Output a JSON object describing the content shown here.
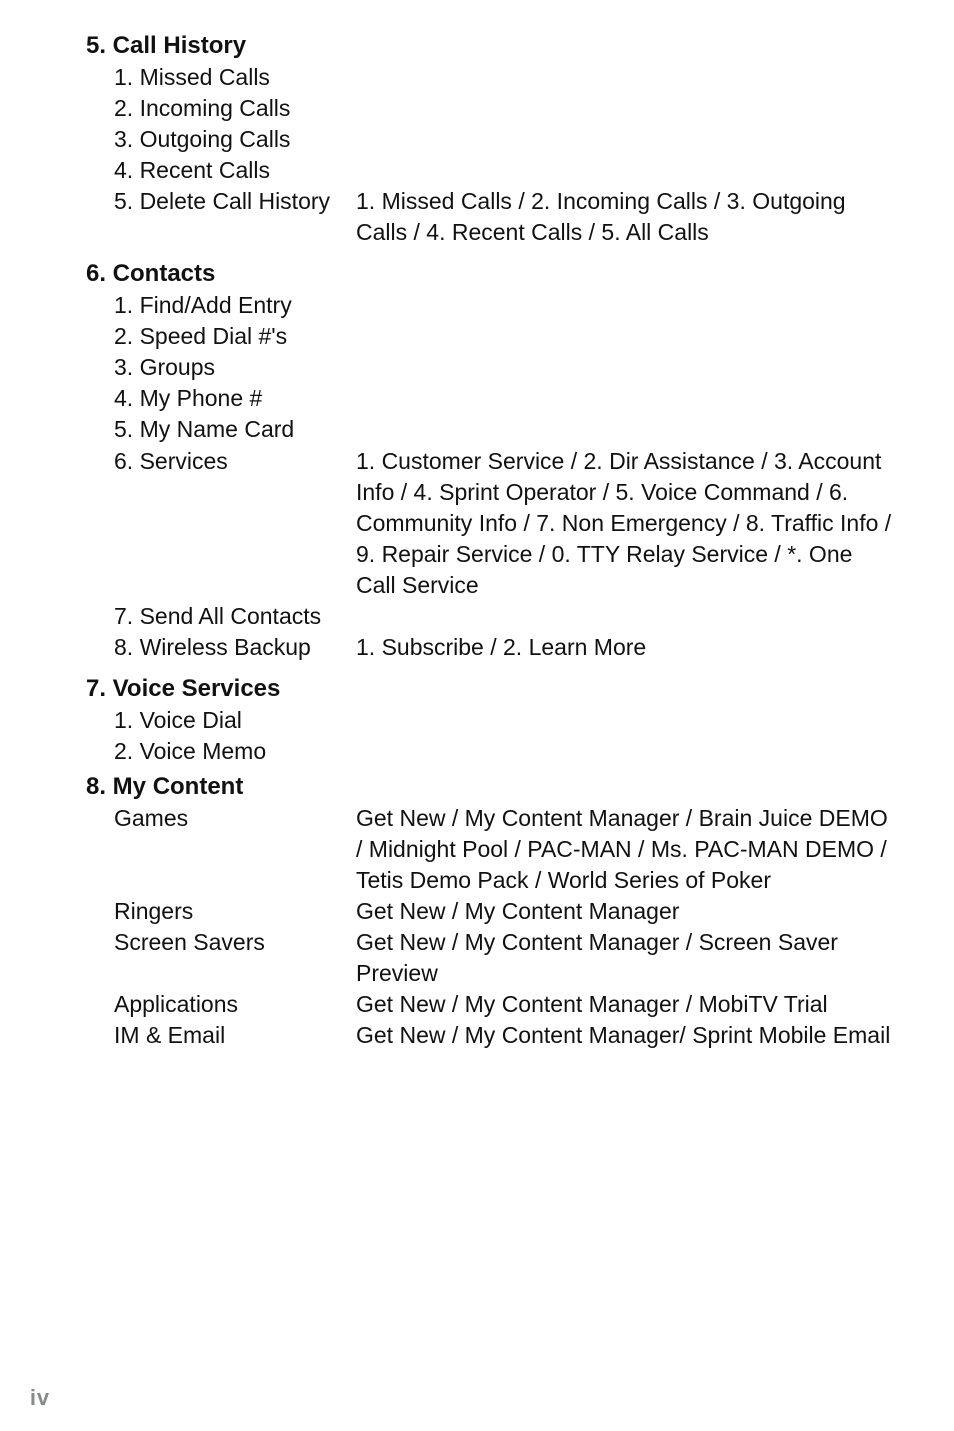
{
  "footer": "iv",
  "sections": {
    "s5": {
      "title": "5. Call History",
      "items": {
        "i1": "1.  Missed Calls",
        "i2": "2.  Incoming Calls",
        "i3": "3.  Outgoing Calls",
        "i4": "4.  Recent Calls",
        "i5_label": "5.  Delete Call History",
        "i5_desc": "1. Missed Calls / 2. Incoming Calls / 3. Outgoing Calls / 4. Recent Calls / 5. All Calls"
      }
    },
    "s6": {
      "title": "6. Contacts",
      "items": {
        "i1": "1.  Find/Add  Entry",
        "i2": "2.  Speed Dial #'s",
        "i3": "3.  Groups",
        "i4": "4.  My Phone #",
        "i5": "5.  My Name Card",
        "i6_label": "6.  Services",
        "i6_desc": "1. Customer Service / 2. Dir Assistance / 3. Account Info / 4. Sprint Operator / 5. Voice Command / 6. Community Info / 7. Non Emergency / 8. Traffic Info / 9. Repair Service / 0. TTY Relay Service / *. One Call Service",
        "i7": "7.  Send All Contacts",
        "i8_label": "8.  Wireless Backup",
        "i8_desc": "1. Subscribe / 2. Learn More"
      }
    },
    "s7": {
      "title": "7. Voice Services",
      "items": {
        "i1": "1.  Voice Dial",
        "i2": "2.  Voice Memo"
      }
    },
    "s8": {
      "title": "8. My Content",
      "items": {
        "games_label": "Games",
        "games_desc": "Get New / My Content Manager / Brain Juice DEMO / Midnight Pool / PAC-MAN / Ms. PAC-MAN DEMO / Tetis Demo Pack / World Series of Poker",
        "ringers_label": "Ringers",
        "ringers_desc": "Get New / My Content Manager",
        "savers_label": "Screen Savers",
        "savers_desc": "Get New / My Content Manager / Screen Saver Preview",
        "apps_label": "Applications",
        "apps_desc": "Get New / My Content Manager / MobiTV Trial",
        "im_label": "IM & Email",
        "im_desc": "Get New / My Content Manager/ Sprint Mobile Email"
      }
    }
  }
}
